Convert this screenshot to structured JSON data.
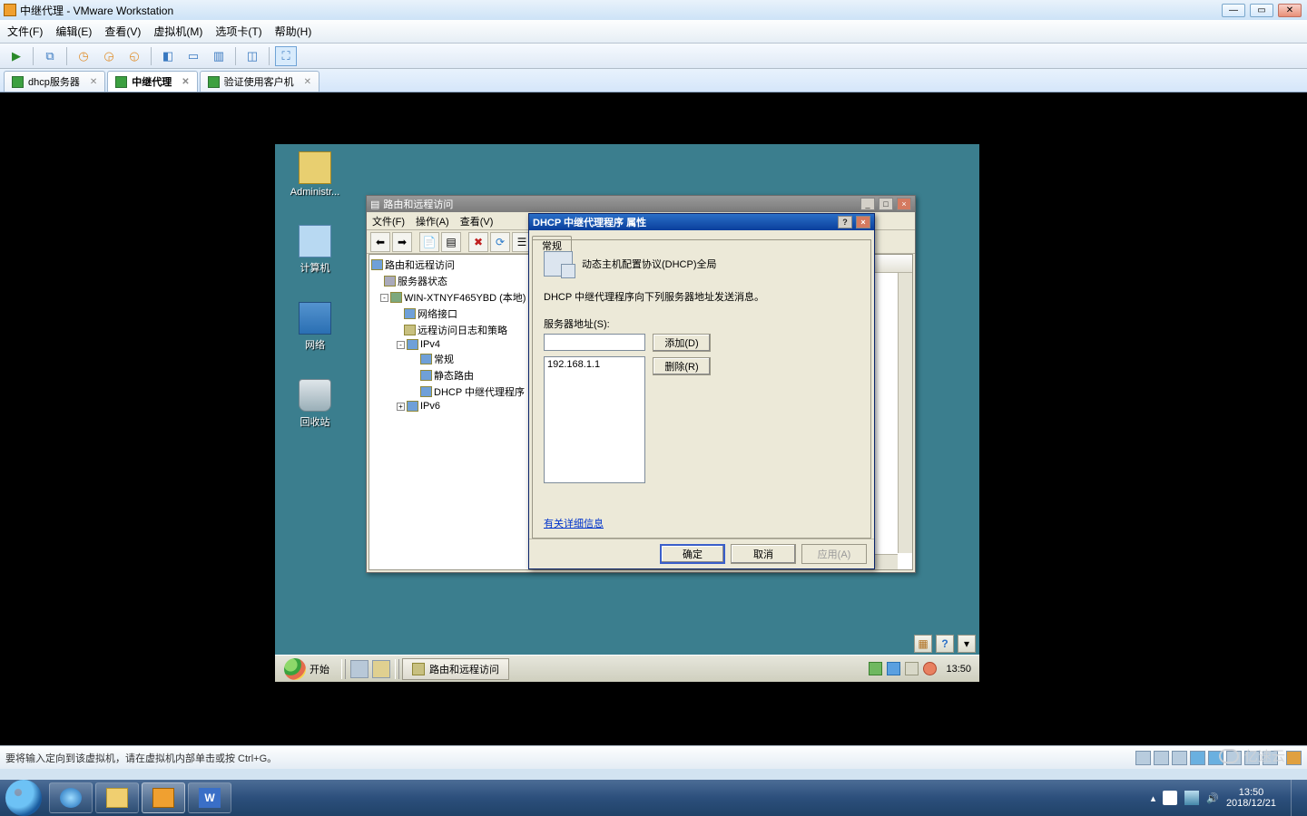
{
  "host": {
    "title": "中继代理 - VMware Workstation",
    "menu": [
      "文件(F)",
      "编辑(E)",
      "查看(V)",
      "虚拟机(M)",
      "选项卡(T)",
      "帮助(H)"
    ],
    "tabs": [
      {
        "label": "dhcp服务器",
        "active": false
      },
      {
        "label": "中继代理",
        "active": true
      },
      {
        "label": "验证使用客户机",
        "active": false
      }
    ],
    "status_hint": "要将输入定向到该虚拟机，请在虚拟机内部单击或按 Ctrl+G。",
    "win7_time": "13:50",
    "win7_date": "2018/12/21"
  },
  "guest_desktop": {
    "icons": [
      "Administr...",
      "计算机",
      "网络",
      "回收站"
    ]
  },
  "mmc": {
    "title": "路由和远程访问",
    "menu": [
      "文件(F)",
      "操作(A)",
      "查看(V)"
    ],
    "tree": {
      "root": "路由和远程访问",
      "status": "服务器状态",
      "server": "WIN-XTNYF465YBD (本地)",
      "n1": "网络接口",
      "n2": "远程访问日志和策略",
      "ipv4": "IPv4",
      "ipv4_children": [
        "常规",
        "静态路由",
        "DHCP 中继代理程序"
      ],
      "ipv6": "IPv6"
    }
  },
  "dialog": {
    "title": "DHCP 中继代理程序 属性",
    "tab": "常规",
    "header": "动态主机配置协议(DHCP)全局",
    "desc": "DHCP 中继代理程序向下列服务器地址发送消息。",
    "field_label": "服务器地址(S):",
    "ip_input": "",
    "listbox": [
      "192.168.1.1"
    ],
    "btn_add": "添加(D)",
    "btn_del": "删除(R)",
    "link": "有关详细信息",
    "btn_ok": "确定",
    "btn_cancel": "取消",
    "btn_apply": "应用(A)"
  },
  "srv_taskbar": {
    "start": "开始",
    "task": "路由和远程访问",
    "clock": "13:50"
  },
  "watermark": "亿速云"
}
